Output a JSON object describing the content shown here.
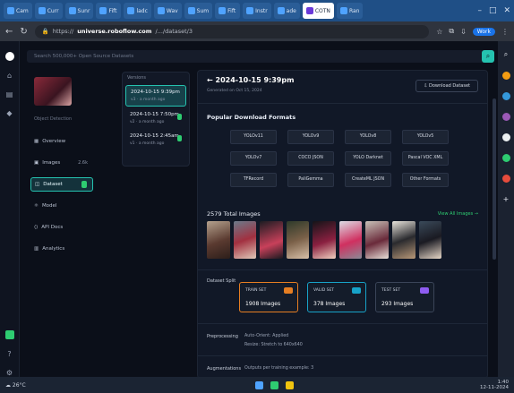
{
  "browser": {
    "tabs": [
      {
        "label": "Cam"
      },
      {
        "label": "Curr"
      },
      {
        "label": "Sunr"
      },
      {
        "label": "Fift"
      },
      {
        "label": "ladc"
      },
      {
        "label": "Wav"
      },
      {
        "label": "Sum"
      },
      {
        "label": "Fift"
      },
      {
        "label": "Instr"
      },
      {
        "label": "ade"
      },
      {
        "label": "COTN",
        "active": true
      },
      {
        "label": "Ran"
      }
    ],
    "url_prefix": "https://",
    "url_domain": "universe.roboflow.com",
    "url_path": "/.../dataset/3",
    "profile_label": "Work"
  },
  "search": {
    "placeholder": "Search 500,000+ Open Source Datasets",
    "button_icon": "search-icon"
  },
  "sidebar": {
    "project_label": "Object Detection",
    "items": [
      {
        "label": "Overview",
        "icon": "overview-icon",
        "badge": ""
      },
      {
        "label": "Images",
        "icon": "images-icon",
        "badge": "2.6k"
      },
      {
        "label": "Dataset",
        "icon": "dataset-icon",
        "badge": "",
        "active": true
      },
      {
        "label": "Model",
        "icon": "model-icon",
        "badge": ""
      },
      {
        "label": "API Docs",
        "icon": "api-icon",
        "badge": ""
      },
      {
        "label": "Analytics",
        "icon": "analytics-icon",
        "badge": ""
      }
    ]
  },
  "versions": {
    "header": "Versions",
    "items": [
      {
        "title": "2024-10-15 9:39pm",
        "sub": "v3 · a month ago",
        "active": true
      },
      {
        "title": "2024-10-15 7:50pm",
        "sub": "v2 · a month ago"
      },
      {
        "title": "2024-10-15 2:45am",
        "sub": "v1 · a month ago"
      }
    ]
  },
  "main": {
    "title": "2024-10-15 9:39pm",
    "subtitle": "Generated on Oct 15, 2024",
    "download_button": "Download Dataset",
    "formats_title": "Popular Download Formats",
    "formats": [
      "YOLOv11",
      "YOLOv9",
      "YOLOv8",
      "YOLOv5",
      "YOLOv7",
      "COCO JSON",
      "YOLO Darknet",
      "Pascal VOC XML",
      "TFRecord",
      "PaliGemma",
      "CreateML JSON",
      "Other Formats"
    ],
    "images_title": "2579 Total Images",
    "view_all": "View All Images →",
    "split_title": "Dataset Split",
    "splits": [
      {
        "label": "TRAIN SET",
        "value": "1908 Images",
        "tag_color": "#e67e22",
        "border": "#e67e22"
      },
      {
        "label": "VALID SET",
        "value": "378 Images",
        "tag_color": "#17a2c8",
        "border": "#17a2c8"
      },
      {
        "label": "TEST SET",
        "value": "293 Images",
        "tag_color": "#8e5cf0",
        "border": "#3a4458"
      }
    ],
    "preprocessing_label": "Preprocessing",
    "preprocessing_lines": [
      "Auto-Orient: Applied",
      "Resize: Stretch to 640x640"
    ],
    "augmentations_label": "Augmentations",
    "augmentations_lines": [
      "Outputs per training example: 3"
    ]
  },
  "taskbar": {
    "weather": "26°C",
    "time": "1:40",
    "date": "12-11-2024"
  }
}
